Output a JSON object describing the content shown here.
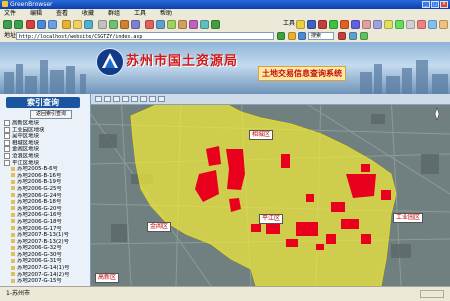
{
  "window": {
    "title": "GreenBrowser"
  },
  "menu": [
    "文件",
    "编辑",
    "查看",
    "收藏",
    "群组",
    "工具",
    "帮助"
  ],
  "toolbar": {
    "right_label": "工具"
  },
  "address": {
    "label": "地址",
    "url": "http://localhost/website/CSGTZY/index.asp",
    "zoom": "搜索"
  },
  "header": {
    "title": "苏州市国土资源局",
    "subtitle": "土地交易信息查询系统"
  },
  "sidebar": {
    "title": "索引查询",
    "button": "返回索引查询",
    "tree": [
      {
        "label": "高新区地块",
        "kind": "plus",
        "level": 0
      },
      {
        "label": "工业园区地块",
        "kind": "plus",
        "level": 0
      },
      {
        "label": "吴中区地块",
        "kind": "plus",
        "level": 0
      },
      {
        "label": "相城区地块",
        "kind": "plus",
        "level": 0
      },
      {
        "label": "金阊区地块",
        "kind": "plus",
        "level": 0
      },
      {
        "label": "沧浪区地块",
        "kind": "plus",
        "level": 0
      },
      {
        "label": "平江区地块",
        "kind": "minus",
        "level": 0
      },
      {
        "label": "苏地2005-B-6号",
        "kind": "item",
        "level": 1
      },
      {
        "label": "苏地2006-B-16号",
        "kind": "item",
        "level": 1
      },
      {
        "label": "苏地2006-B-19号",
        "kind": "item",
        "level": 1
      },
      {
        "label": "苏地2006-G-25号",
        "kind": "item",
        "level": 1
      },
      {
        "label": "苏地2006-G-24号",
        "kind": "item",
        "level": 1
      },
      {
        "label": "苏地2006-B-18号",
        "kind": "item",
        "level": 1
      },
      {
        "label": "苏地2006-G-20号",
        "kind": "item",
        "level": 1
      },
      {
        "label": "苏地2006-G-16号",
        "kind": "item",
        "level": 1
      },
      {
        "label": "苏地2006-G-18号",
        "kind": "item",
        "level": 1
      },
      {
        "label": "苏地2006-G-17号",
        "kind": "item",
        "level": 1
      },
      {
        "label": "苏地2007-B-13(1)号",
        "kind": "item",
        "level": 1
      },
      {
        "label": "苏地2007-B-13(2)号",
        "kind": "item",
        "level": 1
      },
      {
        "label": "苏地2006-G-32号",
        "kind": "item",
        "level": 1
      },
      {
        "label": "苏地2006-G-30号",
        "kind": "item",
        "level": 1
      },
      {
        "label": "苏地2006-G-31号",
        "kind": "item",
        "level": 1
      },
      {
        "label": "苏地2007-G-14(1)号",
        "kind": "item",
        "level": 1
      },
      {
        "label": "苏地2007-G-14(2)号",
        "kind": "item",
        "level": 1
      },
      {
        "label": "苏地2007-G-15号",
        "kind": "item",
        "level": 1
      }
    ]
  },
  "map": {
    "labels": {
      "xiangcheng": "相城区",
      "jinchang": "金阊区",
      "pingjiang": "平江区",
      "yuanqu": "工业园区",
      "gaoxin": "高新区"
    },
    "colors": {
      "selection": "#f2ec3a",
      "parcel": "#e8001c"
    }
  },
  "status": {
    "text": "1-苏州市"
  }
}
